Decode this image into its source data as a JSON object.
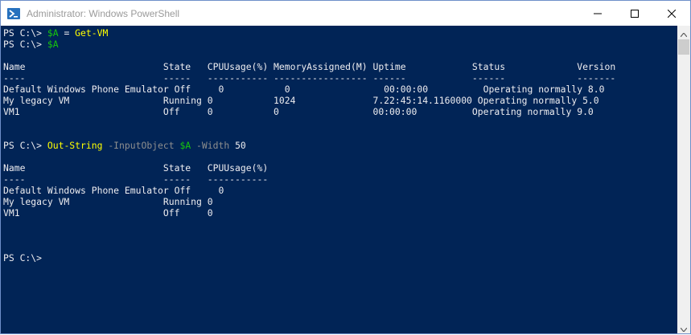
{
  "window": {
    "title": "Administrator: Windows PowerShell",
    "icon": "powershell-icon",
    "controls": [
      "minimize-icon",
      "maximize-icon",
      "close-icon"
    ]
  },
  "console": {
    "prompt": "PS C:\\> ",
    "lines": [
      {
        "kind": "cmd1",
        "prompt": "PS C:\\> ",
        "var": "$A",
        "op": " = ",
        "cmd": "Get-VM"
      },
      {
        "kind": "cmd2",
        "prompt": "PS C:\\> ",
        "var": "$A"
      },
      {
        "kind": "header",
        "text": "Name                         State   CPUUsage(%) MemoryAssigned(M) Uptime            Status             Version"
      },
      {
        "kind": "dashes",
        "text": "----                         -----   ----------- ----------------- ------            ------             -------"
      },
      {
        "kind": "row",
        "text": "Default Windows Phone Emulator Off     0           0                 00:00:00          Operating normally 8.0"
      },
      {
        "kind": "row",
        "text": "My legacy VM                 Running 0           1024              7.22:45:14.1160000 Operating normally 5.0"
      },
      {
        "kind": "row",
        "text": "VM1                          Off     0           0                 00:00:00          Operating normally 9.0"
      },
      {
        "kind": "cmd3",
        "prompt": "PS C:\\> ",
        "cmd": "Out-String",
        "p1": "-InputObject",
        "var": "$A",
        "p2": "-Width",
        "num": "50"
      },
      {
        "kind": "header2",
        "text": "Name                         State   CPUUsage(%)"
      },
      {
        "kind": "dashes2",
        "text": "----                         -----   -----------"
      },
      {
        "kind": "row2",
        "text": "Default Windows Phone Emulator Off     0"
      },
      {
        "kind": "row2",
        "text": "My legacy VM                 Running 0"
      },
      {
        "kind": "row2",
        "text": "VM1                          Off     0"
      },
      {
        "kind": "prompt",
        "text": "PS C:\\>"
      }
    ]
  },
  "colors": {
    "background": "#012456",
    "foreground": "#eeedf0",
    "command": "#ffff00",
    "variable": "#16c60c",
    "parameter": "#8e8e8e"
  }
}
